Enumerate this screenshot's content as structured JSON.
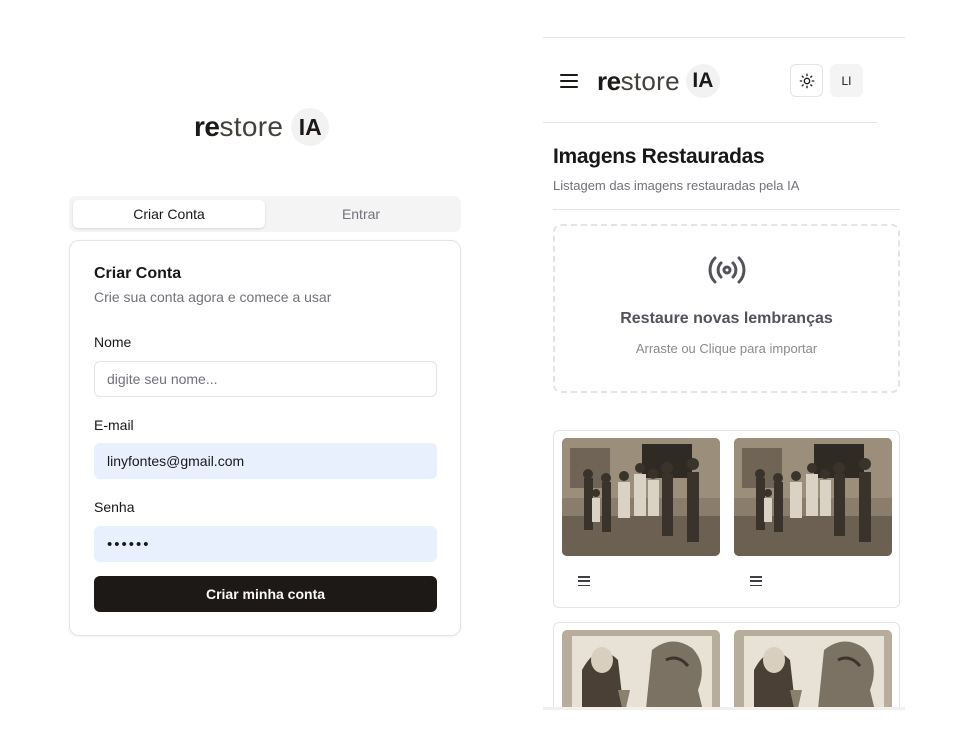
{
  "logo": {
    "part_bold": "re",
    "part_light": "store",
    "badge": "IA"
  },
  "auth": {
    "tabs": [
      {
        "label": "Criar Conta",
        "active": true
      },
      {
        "label": "Entrar",
        "active": false
      }
    ],
    "card": {
      "title": "Criar Conta",
      "subtitle": "Crie sua conta agora e comece a usar",
      "fields": {
        "name": {
          "label": "Nome",
          "placeholder": "digite seu nome...",
          "value": ""
        },
        "email": {
          "label": "E-mail",
          "value": "linyfontes@gmail.com"
        },
        "password": {
          "label": "Senha",
          "value": "••••••"
        }
      },
      "submit_label": "Criar minha conta"
    }
  },
  "dashboard": {
    "avatar_initials": "LI",
    "title": "Imagens Restauradas",
    "subtitle": "Listagem das imagens restauradas pela IA",
    "dropzone": {
      "title": "Restaure novas lembranças",
      "subtitle": "Arraste ou Clique para importar",
      "icon": "radio-tower-icon"
    }
  },
  "colors": {
    "primary": "#1c1917",
    "autofill": "#e8f0fe",
    "border": "#e4e4e7",
    "muted": "#71717a"
  }
}
